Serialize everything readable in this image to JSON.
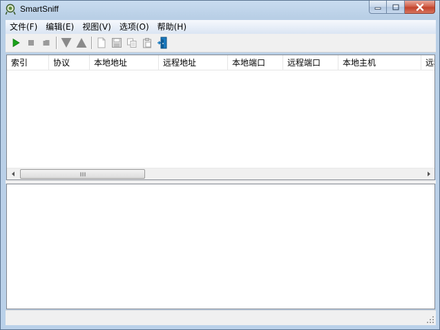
{
  "window": {
    "title": "SmartSniff"
  },
  "menu": {
    "items": [
      {
        "id": "file",
        "label": "文件(F)"
      },
      {
        "id": "edit",
        "label": "编辑(E)"
      },
      {
        "id": "view",
        "label": "视图(V)"
      },
      {
        "id": "options",
        "label": "选项(O)"
      },
      {
        "id": "help",
        "label": "帮助(H)"
      }
    ]
  },
  "toolbar": {
    "buttons": [
      {
        "id": "start",
        "icon": "play-icon",
        "color": "#1aa31a"
      },
      {
        "id": "stop",
        "icon": "stop-icon",
        "color": "#9a9a9a"
      },
      {
        "id": "pause",
        "icon": "pause-icon",
        "color": "#9a9a9a"
      },
      {
        "id": "filter-down",
        "icon": "triangle-down-icon",
        "color": "#8a8a8a"
      },
      {
        "id": "filter-up",
        "icon": "triangle-up-icon",
        "color": "#8a8a8a"
      },
      {
        "id": "new",
        "icon": "blank-page-icon",
        "color": "#b0b0b0"
      },
      {
        "id": "save",
        "icon": "floppy-disk-icon",
        "color": "#b0b0b0"
      },
      {
        "id": "copy",
        "icon": "copy-icon",
        "color": "#b0b0b0"
      },
      {
        "id": "properties",
        "icon": "clipboard-icon",
        "color": "#b0b0b0"
      },
      {
        "id": "exit",
        "icon": "exit-door-icon",
        "color": "#1a7abf"
      }
    ]
  },
  "list": {
    "columns": [
      "索引",
      "协议",
      "本地地址",
      "远程地址",
      "本地端口",
      "远程端口",
      "本地主机",
      "远程"
    ],
    "rows": []
  },
  "status": {
    "text": ""
  }
}
